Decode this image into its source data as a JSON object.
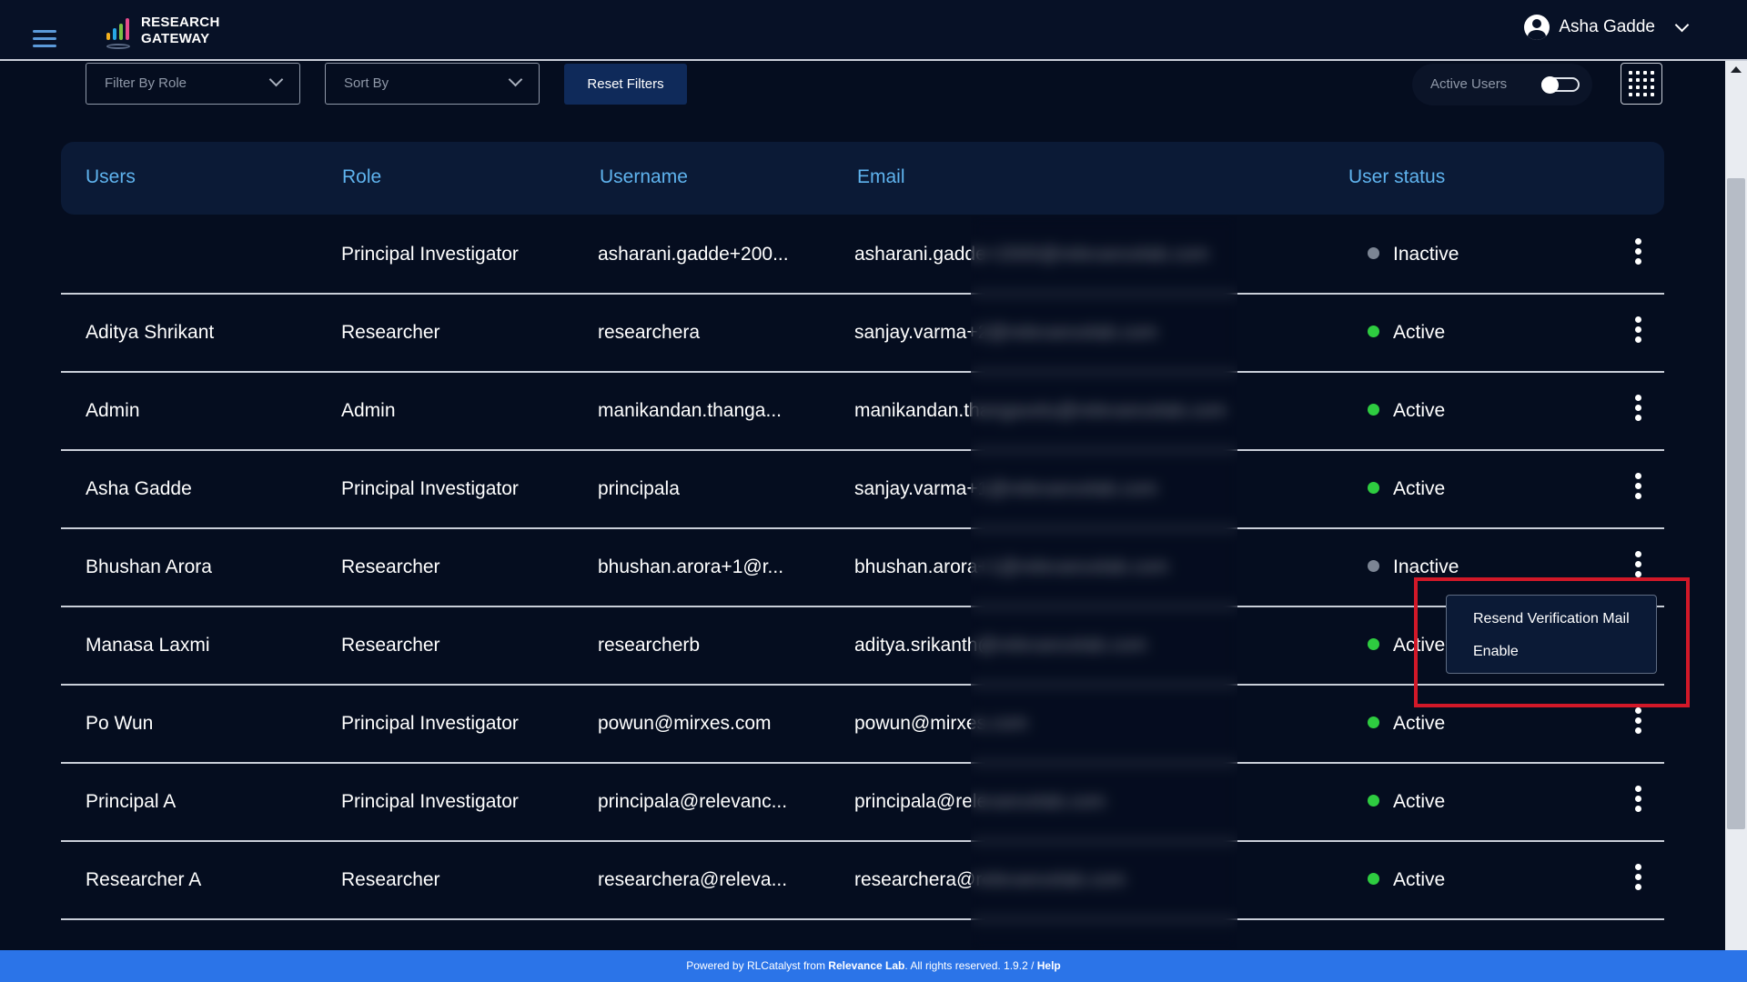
{
  "header": {
    "logo_line1": "RESEARCH",
    "logo_line2": "GATEWAY",
    "user_name": "Asha Gadde"
  },
  "filters": {
    "role_placeholder": "Filter By Role",
    "sort_placeholder": "Sort By",
    "reset_label": "Reset Filters",
    "active_users_label": "Active Users",
    "active_users_on": false
  },
  "table": {
    "columns": [
      "Users",
      "Role",
      "Username",
      "Email",
      "User status"
    ],
    "rows": [
      {
        "name": "",
        "role": "Principal Investigator",
        "username": "asharani.gadde+200...",
        "email": "asharani.gadde+2000@relevancelab.com",
        "status": "Inactive"
      },
      {
        "name": "Aditya Shrikant",
        "role": "Researcher",
        "username": "researchera",
        "email": "sanjay.varma+2@relevancelab.com",
        "status": "Active"
      },
      {
        "name": "Admin",
        "role": "Admin",
        "username": "manikandan.thanga...",
        "email": "manikandan.thangavelu@relevancelab.com",
        "status": "Active"
      },
      {
        "name": "Asha Gadde",
        "role": "Principal Investigator",
        "username": "principala",
        "email": "sanjay.varma+1@relevancelab.com",
        "status": "Active"
      },
      {
        "name": "Bhushan Arora",
        "role": "Researcher",
        "username": "bhushan.arora+1@r...",
        "email": "bhushan.arora+1@relevancelab.com",
        "status": "Inactive"
      },
      {
        "name": "Manasa Laxmi",
        "role": "Researcher",
        "username": "researcherb",
        "email": "aditya.srikanth@relevancelab.com",
        "status": "Active"
      },
      {
        "name": "Po Wun",
        "role": "Principal Investigator",
        "username": "powun@mirxes.com",
        "email": "powun@mirxes.com",
        "status": "Active"
      },
      {
        "name": "Principal A",
        "role": "Principal Investigator",
        "username": "principala@relevanc...",
        "email": "principala@relevancelab.com",
        "status": "Active"
      },
      {
        "name": "Researcher A",
        "role": "Researcher",
        "username": "researchera@releva...",
        "email": "researchera@relevancelab.com",
        "status": "Active"
      }
    ]
  },
  "context_menu": {
    "items": [
      "Resend Verification Mail",
      "Enable"
    ]
  },
  "footer": {
    "prefix": "Powered by RLCatalyst from ",
    "brand": "Relevance Lab",
    "middle": ". All rights reserved. 1.9.2 / ",
    "help": "Help"
  },
  "colors": {
    "background": "#050d1f",
    "header_text": "#5fb3ee",
    "active_dot": "#2ecc40",
    "inactive_dot": "#7c8594",
    "footer": "#2b74e8",
    "highlight": "#d21828"
  },
  "icons": [
    "menu-icon",
    "user-circle-icon",
    "chevron-down-icon",
    "grid-icon",
    "more-vertical-icon"
  ]
}
